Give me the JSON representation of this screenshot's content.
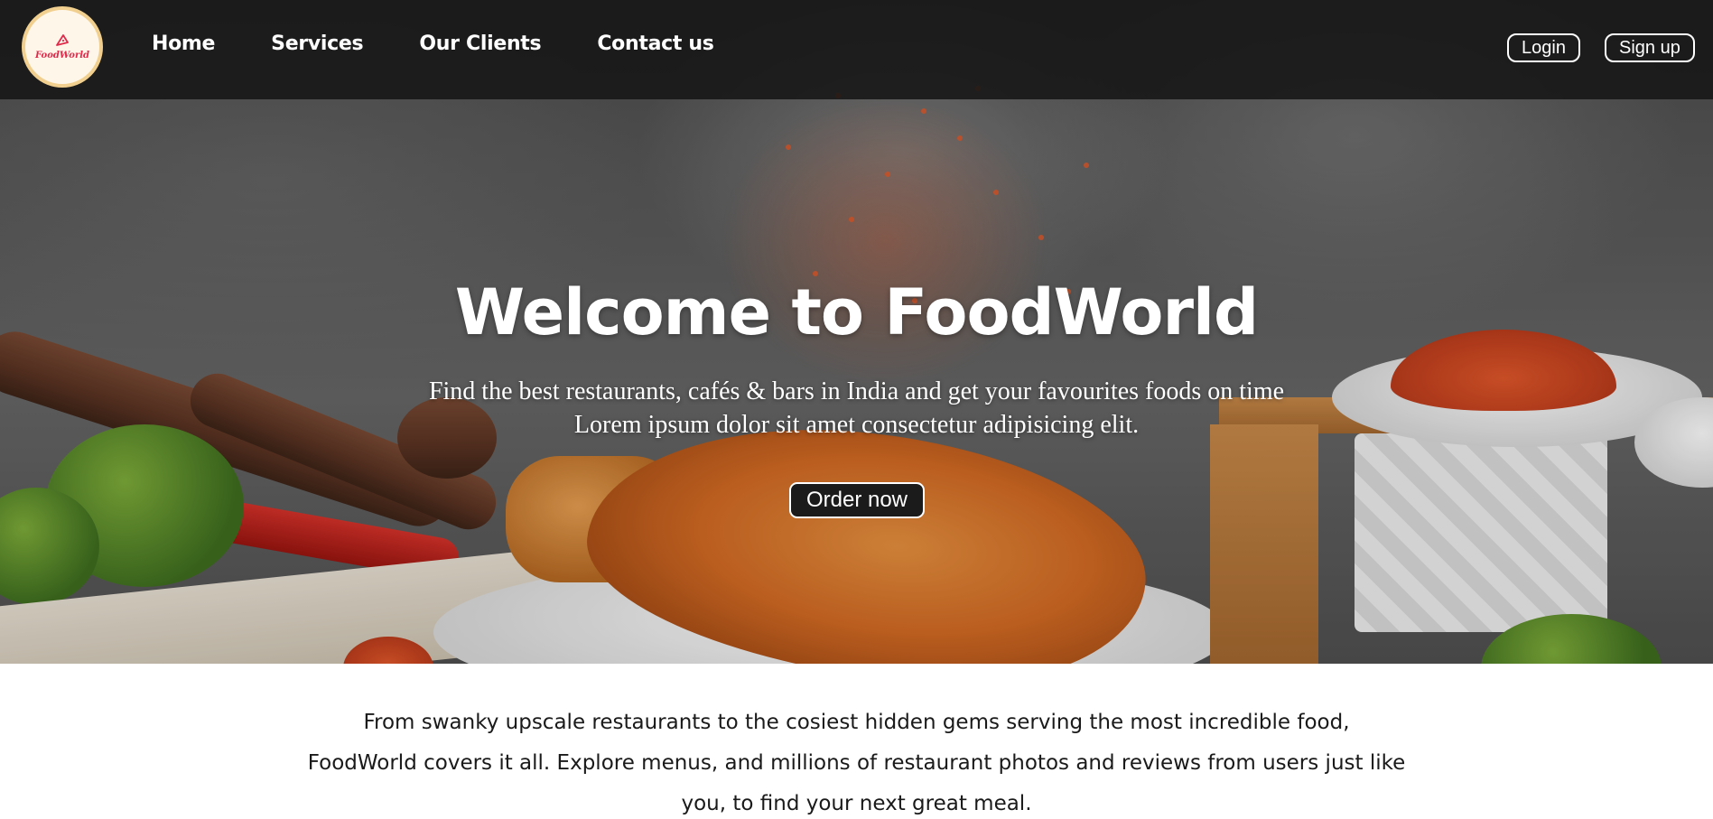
{
  "navbar": {
    "logo_text": "FoodWorld",
    "links": [
      {
        "label": "Home"
      },
      {
        "label": "Services"
      },
      {
        "label": "Our Clients"
      },
      {
        "label": "Contact us"
      }
    ],
    "login_label": "Login",
    "signup_label": "Sign up"
  },
  "hero": {
    "title": "Welcome to FoodWorld",
    "subtitle_line1": "Find the best restaurants, cafés & bars in India and get your favourites foods on time",
    "subtitle_line2": "Lorem ipsum dolor sit amet consectetur adipisicing elit.",
    "cta_label": "Order now"
  },
  "intro": {
    "text": "From swanky upscale restaurants to the cosiest hidden gems serving the most incredible food, FoodWorld covers it all. Explore menus, and millions of restaurant photos and reviews from users just like you, to find your next great meal."
  },
  "colors": {
    "navbar_bg": "#161616",
    "logo_ring": "#f1d08f",
    "logo_text": "#e02a4a",
    "accent_spice": "#e35b2a"
  }
}
